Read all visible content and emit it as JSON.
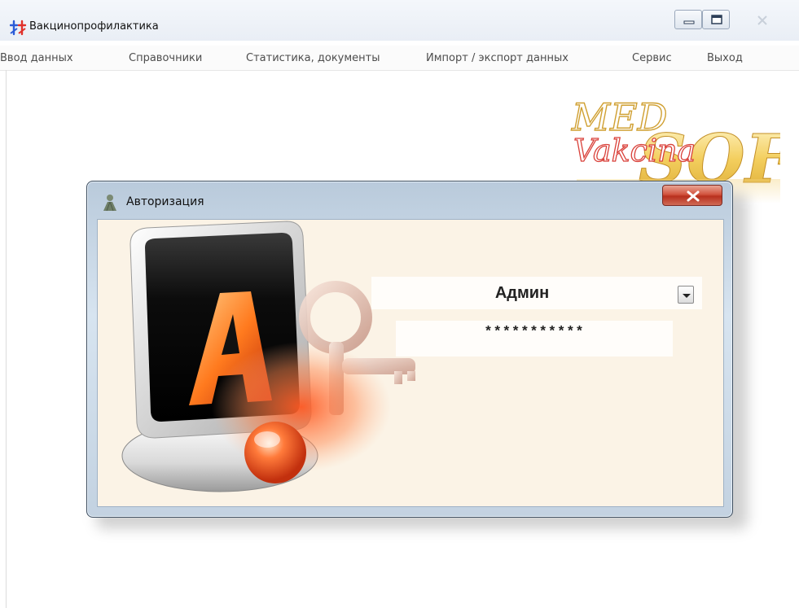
{
  "window": {
    "title": "Вакцинопрофилактика",
    "controls": [
      "minimize-icon",
      "maximize-icon",
      "close-icon"
    ]
  },
  "menu": {
    "items": [
      {
        "label": "Ввод данных"
      },
      {
        "label": "Справочники"
      },
      {
        "label": "Статистика, документы"
      },
      {
        "label": "Импорт / экспорт данных"
      },
      {
        "label": "Сервис"
      },
      {
        "label": "Выход"
      }
    ]
  },
  "logo": {
    "line1": "MED",
    "line2": "Vakcina",
    "line3": "SOFT"
  },
  "dialog": {
    "title": "Авторизация",
    "user_value": "Админ",
    "password_value": "***********"
  },
  "colors": {
    "accent_orange": "#e8501a",
    "dialog_body": "#fbf3e6",
    "close_red": "#c23a25"
  }
}
